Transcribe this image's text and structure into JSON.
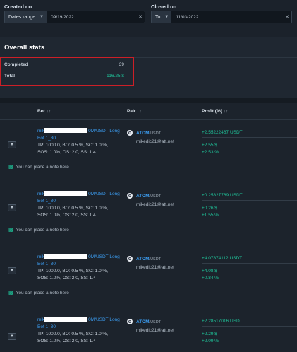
{
  "filters": {
    "created": {
      "label": "Created on",
      "mode": "Dates range",
      "value": "09/19/2022"
    },
    "closed": {
      "label": "Closed on",
      "mode": "To",
      "value": "11/03/2022"
    }
  },
  "stats": {
    "title": "Overall stats",
    "completed_label": "Completed",
    "completed_value": "39",
    "total_label": "Total",
    "total_value": "116.25 $"
  },
  "table": {
    "headers": {
      "bot": "Bot",
      "pair": "Pair",
      "profit": "Profit (%)",
      "sort_glyph": "↓↑"
    },
    "rows": [
      {
        "bot_prefix": "mik",
        "bot_suffix": "0M/USDT Long",
        "bot_id": "Bot 1_30",
        "params": [
          "TP: 1000.0, BO: 0.5 %, SO: 1.0 %,",
          "SOS: 1.0%, OS: 2.0, SS: 1.4"
        ],
        "note": "You can place a note here",
        "pair_base": "ATOM",
        "pair_quote": "/USDT",
        "account": "mikedic21@att.net",
        "profit_main": "+2.55222467 USDT",
        "profit_usd": "+2.55 $",
        "profit_pct": "+2.53 %"
      },
      {
        "bot_prefix": "mik",
        "bot_suffix": "0M/USDT Long",
        "bot_id": "Bot 1_30",
        "params": [
          "TP: 1000.0, BO: 0.5 %, SO: 1.0 %,",
          "SOS: 1.0%, OS: 2.0, SS: 1.4"
        ],
        "note": "You can place a note here",
        "pair_base": "ATOM",
        "pair_quote": "/USDT",
        "account": "mikedic21@att.net",
        "profit_main": "+0.25827769 USDT",
        "profit_usd": "+0.26 $",
        "profit_pct": "+1.55 %"
      },
      {
        "bot_prefix": "mik",
        "bot_suffix": "0M/USDT Long",
        "bot_id": "Bot 1_30",
        "params": [
          "TP: 1000.0, BO: 0.5 %, SO: 1.0 %,",
          "SOS: 1.0%, OS: 2.0, SS: 1.4"
        ],
        "note": "You can place a note here",
        "pair_base": "ATOM",
        "pair_quote": "/USDT",
        "account": "mikedic21@att.net",
        "profit_main": "+4.07874112 USDT",
        "profit_usd": "+4.08 $",
        "profit_pct": "+0.84 %"
      },
      {
        "bot_prefix": "mik",
        "bot_suffix": "0M/USDT Long",
        "bot_id": "Bot 1_30",
        "params": [
          "TP: 1000.0, BO: 0.5 %, SO: 1.0 %,",
          "SOS: 1.0%, OS: 2.0, SS: 1.4"
        ],
        "note": "",
        "pair_base": "ATOM",
        "pair_quote": "/USDT",
        "account": "mikedic21@att.net",
        "profit_main": "+2.28517016 USDT",
        "profit_usd": "+2.29 $",
        "profit_pct": "+2.09 %"
      }
    ]
  },
  "colors": {
    "accent_link": "#3b9cf0",
    "profit_green": "#1fc49a",
    "highlight_red": "#cc1f27",
    "background": "#1b222b"
  },
  "icons": {
    "select_chevron": "chevron-down-icon",
    "clear": "close-icon",
    "expand": "chevron-down-icon",
    "note": "comment-icon",
    "coin": "atom-coin-icon"
  }
}
